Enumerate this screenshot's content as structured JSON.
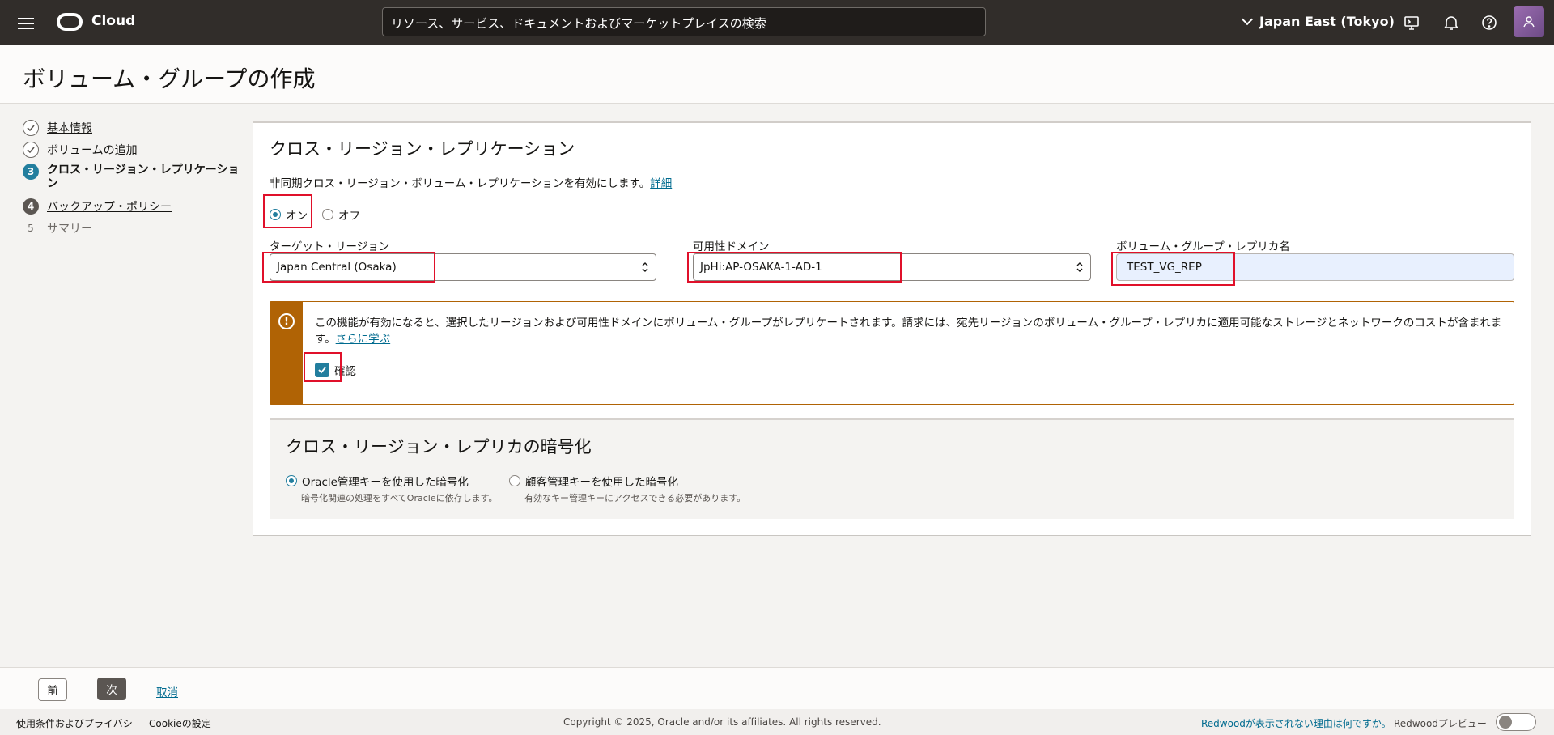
{
  "topbar": {
    "brand": "Cloud",
    "search_placeholder": "リソース、サービス、ドキュメントおよびマーケットプレイスの検索",
    "region": "Japan East (Tokyo)",
    "icons": [
      "menu-icon",
      "cloud-shell-icon",
      "bell-icon",
      "help-icon",
      "avatar"
    ]
  },
  "page": {
    "title": "ボリューム・グループの作成"
  },
  "steps": [
    {
      "label": "基本情報",
      "marker": "",
      "state": "done"
    },
    {
      "label": "ボリュームの追加",
      "marker": "",
      "state": "done"
    },
    {
      "label": "クロス・リージョン・レプリケーション",
      "marker": "3",
      "state": "current"
    },
    {
      "label": "バックアップ・ポリシー",
      "marker": "4",
      "state": "future"
    },
    {
      "label": "サマリー",
      "marker": "5",
      "state": "pending"
    }
  ],
  "replication": {
    "title": "クロス・リージョン・レプリケーション",
    "description": "非同期クロス・リージョン・ボリューム・レプリケーションを有効にします。",
    "details_link": "詳細",
    "radio_on": "オン",
    "radio_off": "オフ",
    "selected": "オン",
    "target_region_label": "ターゲット・リージョン",
    "target_region_value": "Japan Central (Osaka)",
    "ad_label": "可用性ドメイン",
    "ad_value": "JpHi:AP-OSAKA-1-AD-1",
    "replica_name_label": "ボリューム・グループ・レプリカ名",
    "replica_name_value": "TEST_VG_REP",
    "warning_text": "この機能が有効になると、選択したリージョンおよび可用性ドメインにボリューム・グループがレプリケートされます。請求には、宛先リージョンのボリューム・グループ・レプリカに適用可能なストレージとネットワークのコストが含まれます。",
    "learn_more": "さらに学ぶ",
    "confirm_label": "確認",
    "confirm_checked": true
  },
  "encryption": {
    "title": "クロス・リージョン・レプリカの暗号化",
    "option1_label": "Oracle管理キーを使用した暗号化",
    "option1_sub": "暗号化関連の処理をすべてOracleに依存します。",
    "option2_label": "顧客管理キーを使用した暗号化",
    "option2_sub": "有効なキー管理キーにアクセスできる必要があります。",
    "selected": "Oracle管理キーを使用した暗号化"
  },
  "actions": {
    "prev": "前",
    "next": "次",
    "cancel": "取消"
  },
  "footer": {
    "terms": "使用条件およびプライバシ",
    "cookie": "Cookieの設定",
    "copyright": "Copyright © 2025, Oracle and/or its affiliates. All rights reserved.",
    "redwood_link": "Redwoodが表示されない理由は何ですか。",
    "redwood_preview": "Redwoodプレビュー"
  },
  "colors": {
    "accent": "#227e9e",
    "warning": "#b06305",
    "highlight": "#e0102a",
    "topbar": "#312d2a"
  }
}
